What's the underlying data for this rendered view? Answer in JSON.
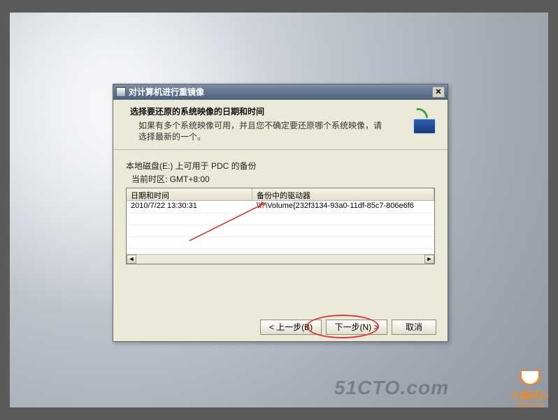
{
  "dialog": {
    "title": "对计算机进行重镜像",
    "heading": "选择要还原的系统映像的日期和时间",
    "subtitle": "如果有多个系统映像可用，并且您不确定要还原哪个系统映像，请选择最新的一个。",
    "info_line": "本地磁盘(E:) 上可用于 PDC 的备份",
    "timezone_line": "当前时区: GMT+8:00",
    "columns": {
      "c1": "日期和时间",
      "c2": "备份中的驱动器"
    },
    "rows": [
      {
        "datetime": "2010/7/22 13:30:31",
        "drives": "\\\\?\\Volume{232f3134-93a0-11df-85c7-806e6f6"
      }
    ],
    "buttons": {
      "back": "< 上一步(B)",
      "next": "下一步(N) >",
      "cancel": "取消"
    }
  },
  "watermark1": "51CTO.com",
  "watermark2": {
    "line1": "九狐问心",
    "line2": "JiuHuCN"
  }
}
